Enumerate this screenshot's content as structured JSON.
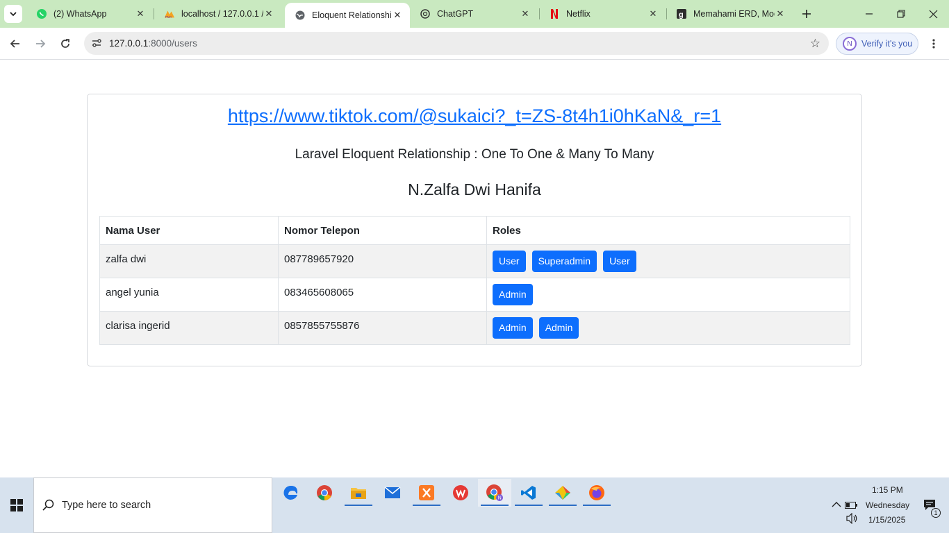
{
  "browser": {
    "tabs": [
      {
        "title": "(2) WhatsApp",
        "icon": "whatsapp-icon",
        "active": false
      },
      {
        "title": "localhost / 127.0.0.1 /",
        "icon": "phpmyadmin-icon",
        "active": false
      },
      {
        "title": "Eloquent Relationship",
        "icon": "globe-icon",
        "active": true
      },
      {
        "title": "ChatGPT",
        "icon": "chatgpt-icon",
        "active": false
      },
      {
        "title": "Netflix",
        "icon": "netflix-icon",
        "active": false
      },
      {
        "title": "Memahami ERD, Mod",
        "icon": "g-icon",
        "active": false
      }
    ],
    "url_host": "127.0.0.1",
    "url_path": ":8000/users",
    "profile_label": "Verify it's you",
    "profile_initial": "N"
  },
  "page": {
    "link_text": "https://www.tiktok.com/@sukaici?_t=ZS-8t4h1i0hKaN&_r=1",
    "subtitle": "Laravel Eloquent Relationship : One To One & Many To Many",
    "author": "N.Zalfa Dwi Hanifa",
    "table": {
      "headers": [
        "Nama User",
        "Nomor Telepon",
        "Roles"
      ],
      "rows": [
        {
          "name": "zalfa dwi",
          "phone": "087789657920",
          "roles": [
            "User",
            "Superadmin",
            "User"
          ]
        },
        {
          "name": "angel yunia",
          "phone": "083465608065",
          "roles": [
            "Admin"
          ]
        },
        {
          "name": "clarisa ingerid",
          "phone": "0857855755876",
          "roles": [
            "Admin",
            "Admin"
          ]
        }
      ]
    }
  },
  "taskbar": {
    "search_placeholder": "Type here to search",
    "apps": [
      "edge-icon",
      "chrome-icon",
      "file-explorer-icon",
      "mail-icon",
      "xampp-icon",
      "wps-office-icon",
      "chrome-profile-icon",
      "vscode-icon",
      "git-icon",
      "firefox-icon"
    ],
    "time": "1:15 PM",
    "day": "Wednesday",
    "date": "1/15/2025",
    "notification_count": "1"
  },
  "colors": {
    "tabstrip": "#c9e9c0",
    "primary": "#0d6efd",
    "stripe": "#f2f2f2"
  }
}
